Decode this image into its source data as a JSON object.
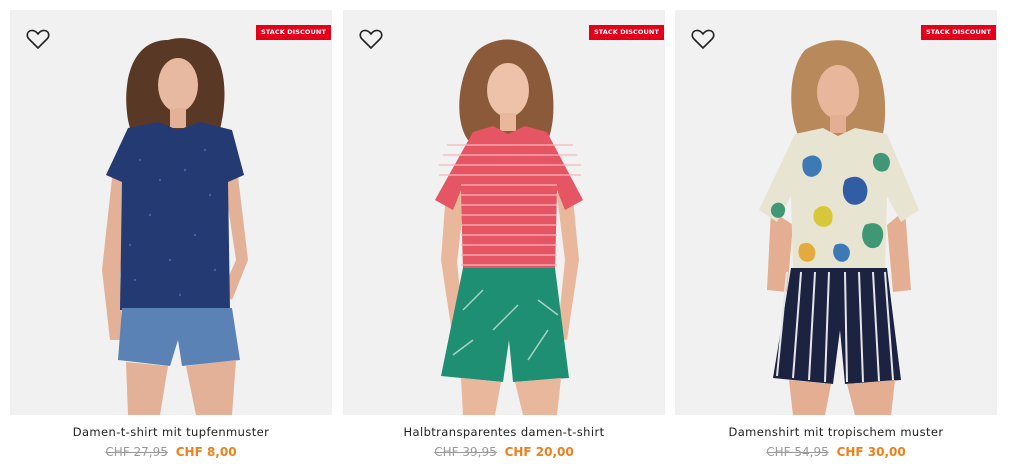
{
  "products": [
    {
      "name": "Damen-t-shirt mit tupfenmuster",
      "badge": "STACK DISCOUNT",
      "old_price": "CHF 27,95",
      "new_price": "CHF 8,00",
      "wishlist_icon": "heart-icon",
      "top_color": "#233a72",
      "bottom_color": "#5b82b4"
    },
    {
      "name": "Halbtransparentes damen-t-shirt",
      "badge": "STACK DISCOUNT",
      "old_price": "CHF 39,95",
      "new_price": "CHF 20,00",
      "wishlist_icon": "heart-icon",
      "top_color": "#e55563",
      "bottom_color": "#1f8f74"
    },
    {
      "name": "Damenshirt mit tropischem muster",
      "badge": "STACK DISCOUNT",
      "old_price": "CHF 54,95",
      "new_price": "CHF 30,00",
      "wishlist_icon": "heart-icon",
      "top_color": "#e8e4d2",
      "bottom_color": "#1c2340"
    }
  ],
  "colors": {
    "badge_bg": "#e3001b",
    "price_sale": "#f07f1a",
    "price_old": "#999999",
    "image_bg": "#f1f1f1"
  }
}
